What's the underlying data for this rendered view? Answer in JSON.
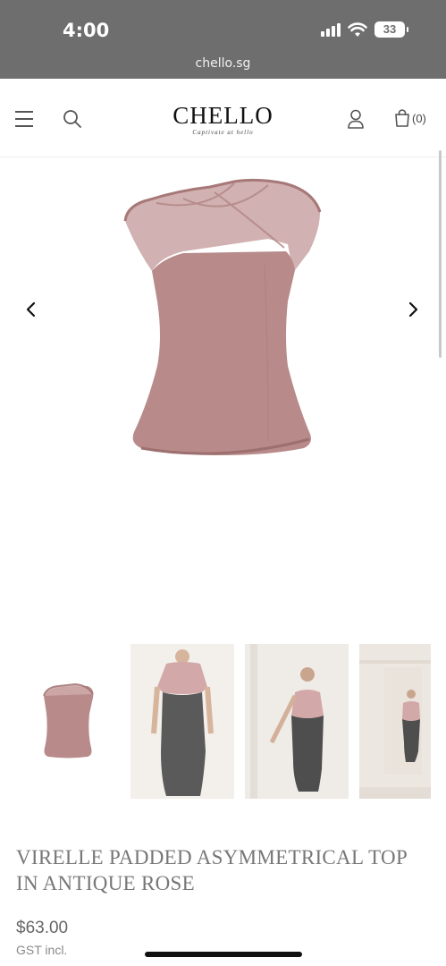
{
  "status_bar": {
    "time": "4:00",
    "battery": "33",
    "url": "chello.sg"
  },
  "header": {
    "logo": "CHELLO",
    "tagline": "Captivate at hello",
    "cart_count": "(0)"
  },
  "product": {
    "title": "VIRELLE PADDED ASYMMETRICAL TOP IN ANTIQUE ROSE",
    "price": "$63.00",
    "tax_note": "GST incl."
  },
  "colors": {
    "rose": "#b88a8a",
    "rose_dark": "#a77878",
    "skirt": "#5c5c5c"
  },
  "icons": [
    "menu-icon",
    "search-icon",
    "account-icon",
    "cart-icon",
    "chevron-left-icon",
    "chevron-right-icon"
  ]
}
